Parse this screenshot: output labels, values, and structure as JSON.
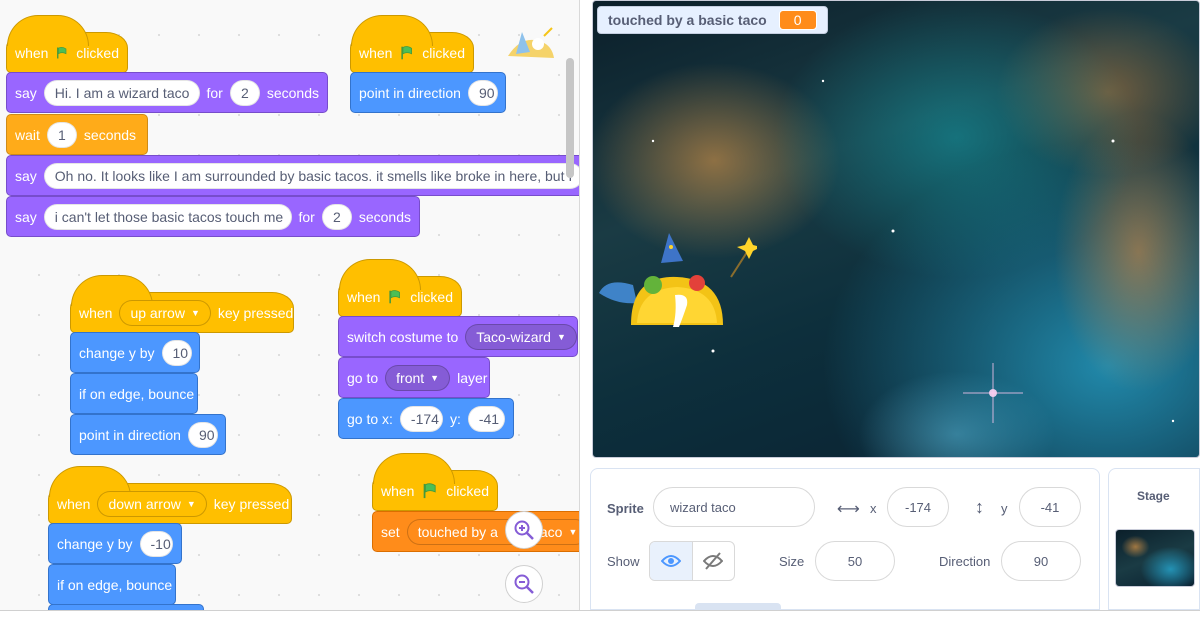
{
  "code": {
    "script1": {
      "hat_when": "when",
      "hat_clicked": "clicked",
      "say1": {
        "cmd": "say",
        "msg": "Hi. I am a wizard taco",
        "for": "for",
        "secs": "2",
        "unit": "seconds"
      },
      "wait": {
        "cmd": "wait",
        "secs": "1",
        "unit": "seconds"
      },
      "say2": {
        "cmd": "say",
        "msg": "Oh no. It looks like I am surrounded by basic tacos. it smells like broke in here, but I"
      },
      "say3": {
        "cmd": "say",
        "msg": "i can't let those basic tacos touch me",
        "for": "for",
        "secs": "2",
        "unit": "seconds"
      }
    },
    "script2": {
      "hat_when": "when",
      "hat_clicked": "clicked",
      "point": {
        "cmd": "point in direction",
        "val": "90"
      }
    },
    "script3": {
      "hat_when": "when",
      "key": "up arrow",
      "hat_pressed": "key pressed",
      "change": {
        "cmd": "change y by",
        "val": "10"
      },
      "bounce": "if on edge, bounce",
      "point": {
        "cmd": "point in direction",
        "val": "90"
      }
    },
    "script4": {
      "hat_when": "when",
      "hat_clicked": "clicked",
      "costume": {
        "cmd": "switch costume to",
        "val": "Taco-wizard"
      },
      "layer": {
        "cmd": "go to",
        "val": "front",
        "unit": "layer"
      },
      "goto": {
        "cmd": "go to x:",
        "x": "-174",
        "ylbl": "y:",
        "y": "-41"
      }
    },
    "script5": {
      "hat_when": "when",
      "key": "down arrow",
      "hat_pressed": "key pressed",
      "change": {
        "cmd": "change y by",
        "val": "-10"
      },
      "bounce": "if on edge, bounce"
    },
    "script6": {
      "hat_when": "when",
      "hat_clicked": "clicked",
      "set": {
        "cmd": "set",
        "var_left": "touched by a",
        "var_right": "aco"
      }
    }
  },
  "monitor": {
    "label": "touched by a basic taco",
    "value": "0"
  },
  "sprite": {
    "sprite_label": "Sprite",
    "name": "wizard taco",
    "x_label": "x",
    "x": "-174",
    "y_label": "y",
    "y": "-41",
    "show_label": "Show",
    "size_label": "Size",
    "size": "50",
    "direction_label": "Direction",
    "direction": "90"
  },
  "stage_panel": {
    "title": "Stage"
  },
  "colors": {
    "events": "#ffbf00",
    "looks": "#9966ff",
    "motion": "#4c97ff",
    "control": "#ffab19",
    "variables": "#ff8c1a"
  }
}
